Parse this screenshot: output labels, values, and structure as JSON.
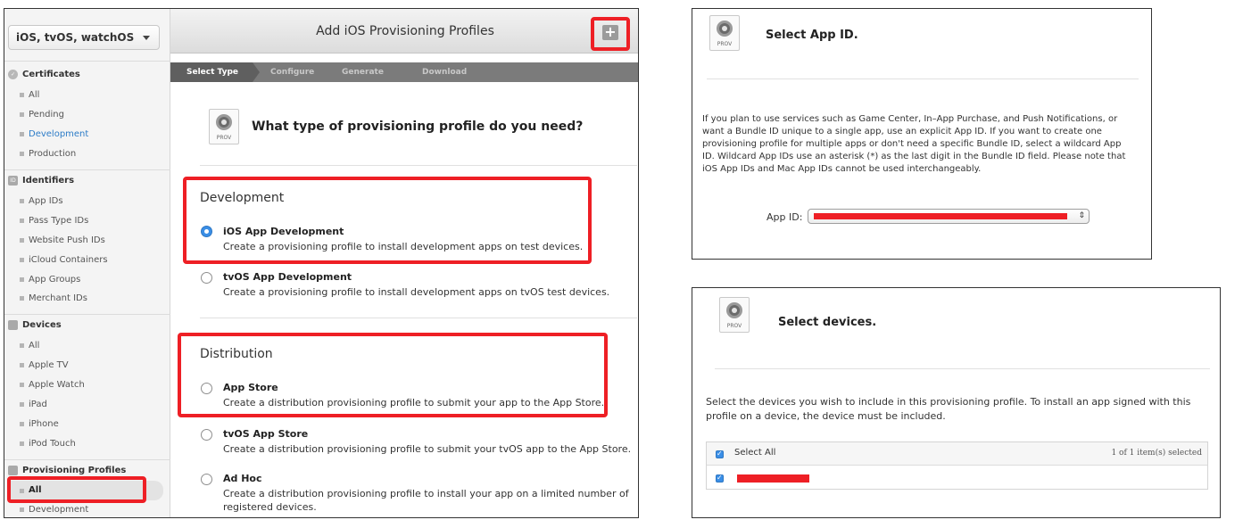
{
  "portal": {
    "platform_select": "iOS, tvOS, watchOS",
    "sidebar": {
      "certificates": {
        "label": "Certificates",
        "items": [
          "All",
          "Pending",
          "Development",
          "Production"
        ]
      },
      "identifiers": {
        "label": "Identifiers",
        "icon_text": "ID",
        "items": [
          "App IDs",
          "Pass Type IDs",
          "Website Push IDs",
          "iCloud Containers",
          "App Groups",
          "Merchant IDs"
        ]
      },
      "devices": {
        "label": "Devices",
        "items": [
          "All",
          "Apple TV",
          "Apple Watch",
          "iPad",
          "iPhone",
          "iPod Touch"
        ]
      },
      "profiles": {
        "label": "Provisioning Profiles",
        "items": [
          "All",
          "Development"
        ]
      }
    },
    "header": {
      "title": "Add iOS Provisioning Profiles",
      "plus": "+"
    },
    "steps": [
      "Select Type",
      "Configure",
      "Generate",
      "Download"
    ],
    "prov_caption": "PROV",
    "question": "What type of provisioning profile do you need?",
    "development": {
      "title": "Development",
      "options": [
        {
          "title": "iOS App Development",
          "desc": "Create a provisioning profile to install development apps on test devices."
        },
        {
          "title": "tvOS App Development",
          "desc": "Create a provisioning profile to install development apps on tvOS test devices."
        }
      ]
    },
    "distribution": {
      "title": "Distribution",
      "options": [
        {
          "title": "App Store",
          "desc": "Create a distribution provisioning profile to submit your app to the App Store."
        },
        {
          "title": "tvOS App Store",
          "desc": "Create a distribution provisioning profile to submit your tvOS app to the App Store."
        },
        {
          "title": "Ad Hoc",
          "desc": "Create a distribution provisioning profile to install your app on a limited number of registered devices."
        }
      ]
    }
  },
  "select_app_id": {
    "title": "Select App ID.",
    "paragraph": "If you plan to use services such as Game Center, In–App Purchase, and Push Notifications, or want a Bundle ID unique to a single app, use an explicit App ID. If you want to create one provisioning profile for multiple apps or don't need a specific Bundle ID, select a wildcard App ID. Wildcard App IDs use an asterisk (*) as the last digit in the Bundle ID field. Please note that iOS App IDs and Mac App IDs cannot be used interchangeably.",
    "label": "App ID:"
  },
  "select_devices": {
    "title": "Select devices.",
    "paragraph": "Select the devices you wish to include in this provisioning profile. To install an app signed with this profile on a device, the device must be included.",
    "select_all": "Select All",
    "count": "1  of 1 item(s) selected"
  },
  "colors": {
    "highlight": "#ee1f25",
    "accent": "#3a8ee6",
    "link": "#2d7cc7"
  }
}
